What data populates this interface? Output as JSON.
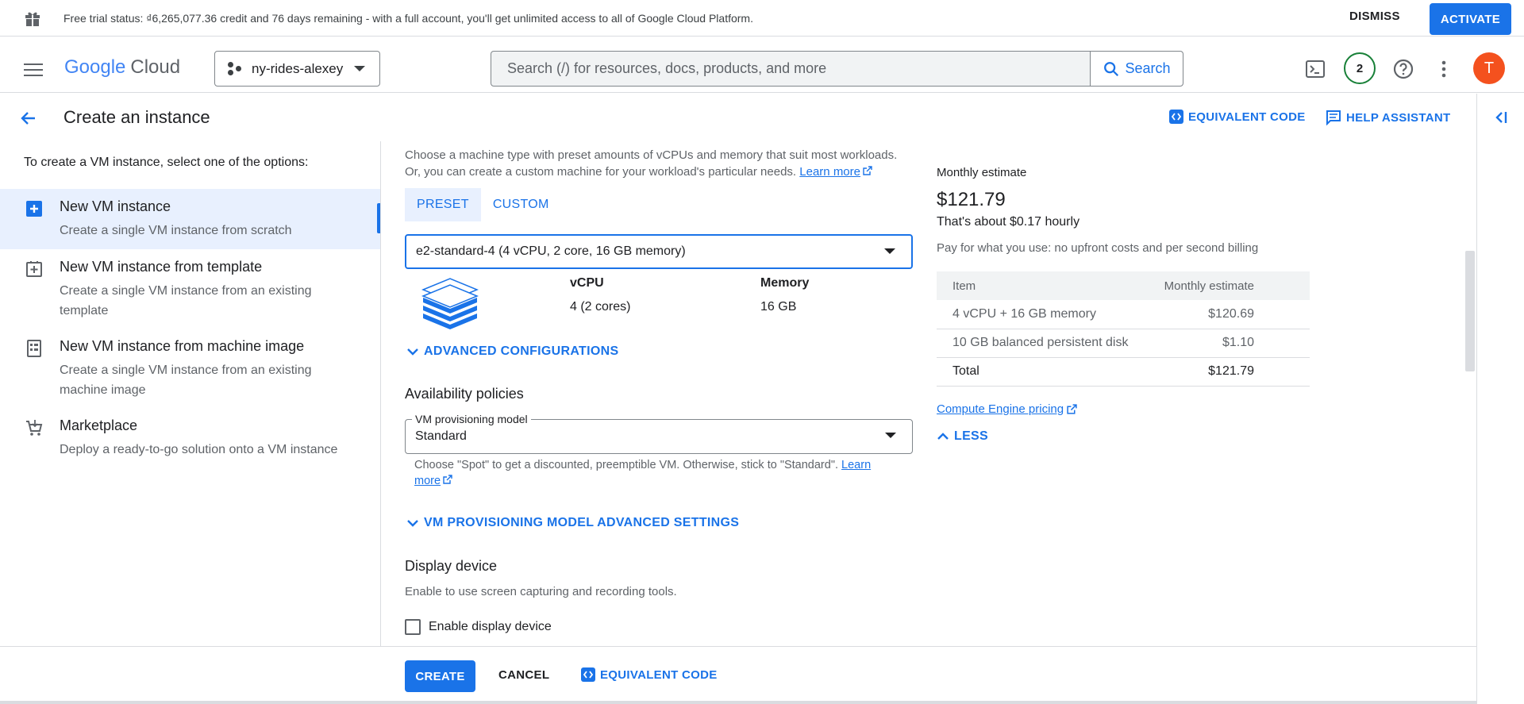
{
  "banner": {
    "text": "Free trial status: ₫6,265,077.36 credit and 76 days remaining - with a full account, you'll get unlimited access to all of Google Cloud Platform.",
    "dismiss_label": "DISMISS",
    "activate_label": "ACTIVATE"
  },
  "topnav": {
    "logo_google": "Google",
    "logo_cloud": "Cloud",
    "project_name": "ny-rides-alexey",
    "search_placeholder": "Search (/) for resources, docs, products, and more",
    "search_button": "Search",
    "notifications_count": "2",
    "avatar_letter": "T"
  },
  "header": {
    "title": "Create an instance",
    "equivalent_code": "EQUIVALENT CODE",
    "help_assistant": "HELP ASSISTANT"
  },
  "left_panel": {
    "intro": "To create a VM instance, select one of the options:",
    "options": [
      {
        "title": "New VM instance",
        "desc": "Create a single VM instance from scratch",
        "icon": "add-box-icon"
      },
      {
        "title": "New VM instance from template",
        "desc": "Create a single VM instance from an existing template",
        "icon": "template-icon"
      },
      {
        "title": "New VM instance from machine image",
        "desc": "Create a single VM instance from an existing machine image",
        "icon": "machine-image-icon"
      },
      {
        "title": "Marketplace",
        "desc": "Deploy a ready-to-go solution onto a VM instance",
        "icon": "cart-icon"
      }
    ]
  },
  "machine": {
    "desc_line1": "Choose a machine type with preset amounts of vCPUs and memory that suit most workloads.",
    "desc_line2": "Or, you can create a custom machine for your workload's particular needs.",
    "learn_more": "Learn more",
    "tabs": [
      "PRESET",
      "CUSTOM"
    ],
    "selected_type": "e2-standard-4 (4 vCPU, 2 core, 16 GB memory)",
    "vcpu_label": "vCPU",
    "vcpu_value": "4 (2 cores)",
    "memory_label": "Memory",
    "memory_value": "16 GB",
    "advanced": "ADVANCED CONFIGURATIONS"
  },
  "availability": {
    "title": "Availability policies",
    "field_label": "VM provisioning model",
    "field_value": "Standard",
    "help": "Choose \"Spot\" to get a discounted, preemptible VM. Otherwise, stick to \"Standard\".",
    "learn": "Learn",
    "more": "more",
    "advanced": "VM PROVISIONING MODEL ADVANCED SETTINGS"
  },
  "display": {
    "title": "Display device",
    "desc": "Enable to use screen capturing and recording tools.",
    "checkbox_label": "Enable display device"
  },
  "estimate": {
    "heading": "Monthly estimate",
    "price": "$121.79",
    "hourly": "That's about $0.17 hourly",
    "note": "Pay for what you use: no upfront costs and per second billing",
    "col_item": "Item",
    "col_estimate": "Monthly estimate",
    "rows": [
      {
        "item": "4 vCPU + 16 GB memory",
        "cost": "$120.69"
      },
      {
        "item": "10 GB balanced persistent disk",
        "cost": "$1.10"
      },
      {
        "item": "Total",
        "cost": "$121.79"
      }
    ],
    "pricing_link": "Compute Engine pricing",
    "less": "LESS"
  },
  "footer": {
    "create": "CREATE",
    "cancel": "CANCEL",
    "equivalent_code": "EQUIVALENT CODE"
  },
  "colors": {
    "accent": "#1a73e8",
    "avatar": "#f4511e",
    "badge_ring": "#188038"
  }
}
